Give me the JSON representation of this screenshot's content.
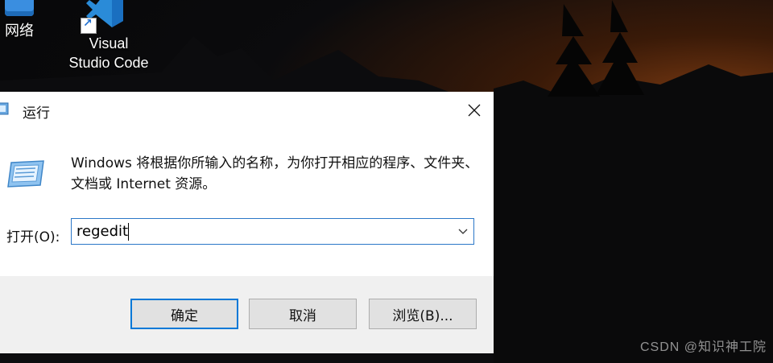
{
  "desktop": {
    "icons": [
      {
        "name": "network",
        "label": "网络"
      },
      {
        "name": "vscode",
        "label_line1": "Visual",
        "label_line2": "Studio Code"
      }
    ],
    "watermark": "CSDN @知识神工院"
  },
  "dialog": {
    "title": "运行",
    "description": "Windows 将根据你所输入的名称，为你打开相应的程序、文件夹、文档或 Internet 资源。",
    "open_label": "打开(O):",
    "input_value": "regedit",
    "buttons": {
      "ok": "确定",
      "cancel": "取消",
      "browse": "浏览(B)..."
    }
  }
}
